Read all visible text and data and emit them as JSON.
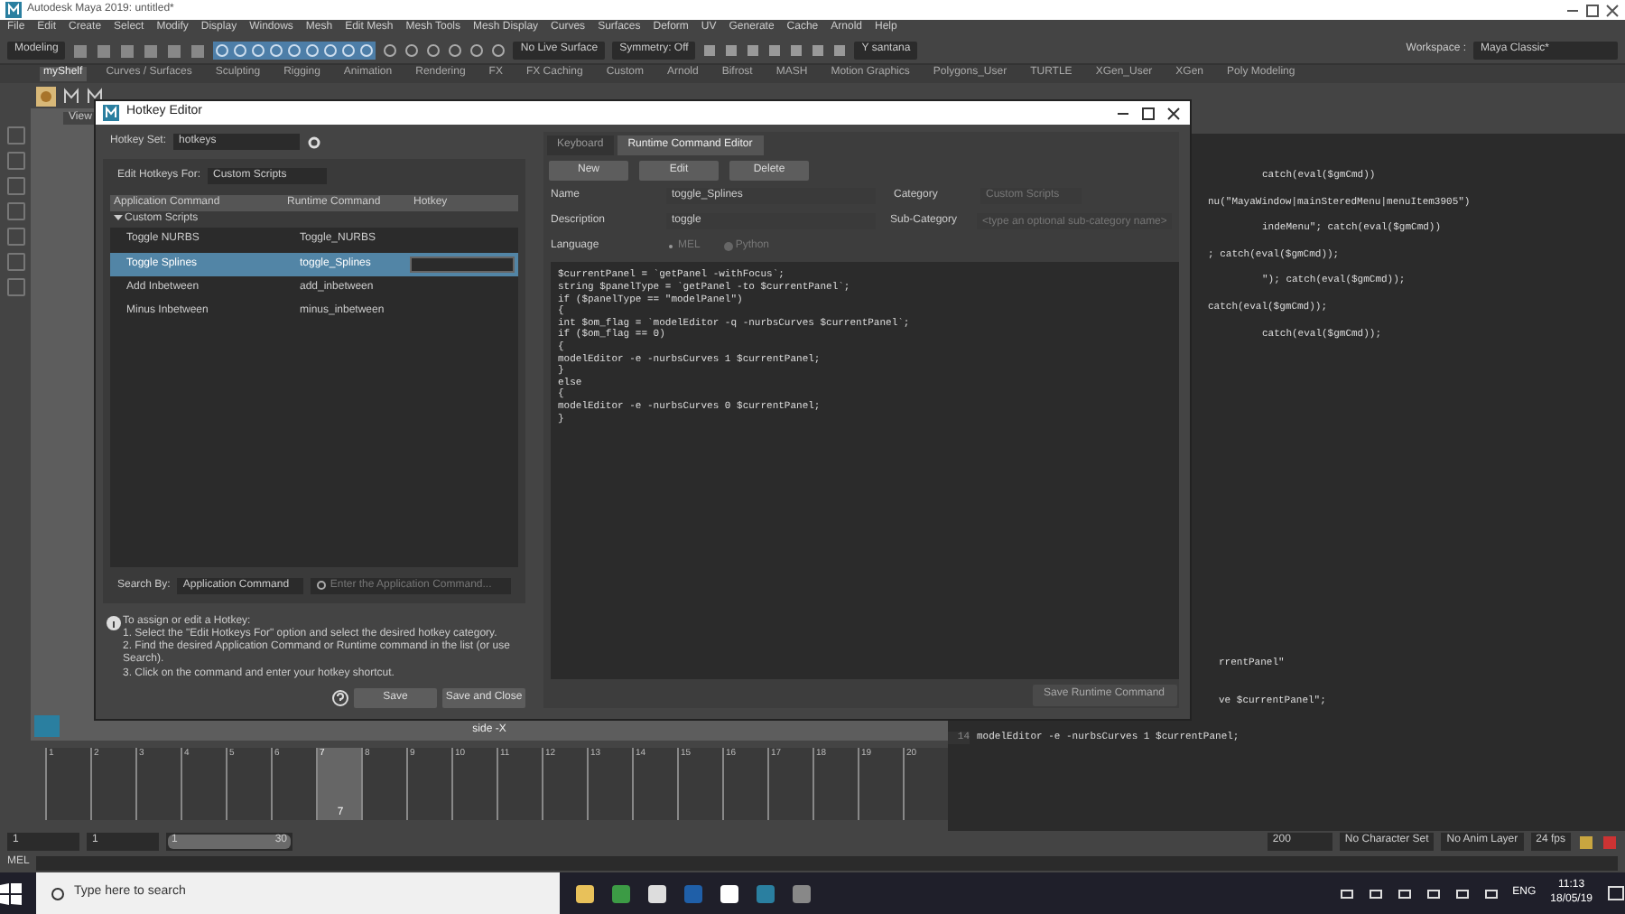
{
  "window": {
    "title": "Autodesk Maya 2019: untitled*"
  },
  "menu": [
    "File",
    "Edit",
    "Create",
    "Select",
    "Modify",
    "Display",
    "Windows",
    "Mesh",
    "Edit Mesh",
    "Mesh Tools",
    "Mesh Display",
    "Curves",
    "Surfaces",
    "Deform",
    "UV",
    "Generate",
    "Cache",
    "Arnold",
    "Help"
  ],
  "toolbar": {
    "mode": "Modeling",
    "live_surface": "No Live Surface",
    "symmetry": "Symmetry: Off",
    "user": "Y santana",
    "workspace_label": "Workspace :",
    "workspace": "Maya Classic*"
  },
  "shelf_tabs": [
    {
      "label": "myShelf",
      "selected": true
    },
    {
      "label": "Curves / Surfaces",
      "selected": false
    },
    {
      "label": "Sculpting",
      "selected": false
    },
    {
      "label": "Rigging",
      "selected": false
    },
    {
      "label": "Animation",
      "selected": false
    },
    {
      "label": "Rendering",
      "selected": false
    },
    {
      "label": "FX",
      "selected": false
    },
    {
      "label": "FX Caching",
      "selected": false
    },
    {
      "label": "Custom",
      "selected": false
    },
    {
      "label": "Arnold",
      "selected": false
    },
    {
      "label": "Bifrost",
      "selected": false
    },
    {
      "label": "MASH",
      "selected": false
    },
    {
      "label": "Motion Graphics",
      "selected": false
    },
    {
      "label": "Polygons_User",
      "selected": false
    },
    {
      "label": "TURTLE",
      "selected": false
    },
    {
      "label": "XGen_User",
      "selected": false
    },
    {
      "label": "XGen",
      "selected": false
    },
    {
      "label": "Poly Modeling",
      "selected": false
    }
  ],
  "viewport": {
    "tab": "View",
    "camera_label": "side -X"
  },
  "script_editor": {
    "upper_lines": [
      "catch(eval($gmCmd))",
      "nu(\"MayaWindow|mainSteredMenu|menuItem3905\")",
      "indeMenu\"; catch(eval($gmCmd))",
      "; catch(eval($gmCmd));",
      "\"); catch(eval($gmCmd));",
      "catch(eval($gmCmd));",
      "catch(eval($gmCmd));"
    ],
    "lower_lines": [
      {
        "text": "rrentPanel\""
      },
      {
        "text": "ve $currentPanel\";"
      },
      {
        "number": "14",
        "text": "modelEditor -e -nurbsCurves 1 $currentPanel;"
      }
    ]
  },
  "hotkey_editor": {
    "title": "Hotkey Editor",
    "hotkey_set_label": "Hotkey Set:",
    "hotkey_set": "hotkeys",
    "edit_for_label": "Edit Hotkeys For:",
    "edit_for": "Custom Scripts",
    "columns": [
      "Application Command",
      "Runtime Command",
      "Hotkey"
    ],
    "group": {
      "label": "Custom Scripts",
      "expanded": true
    },
    "rows": [
      {
        "command": "Toggle NURBS",
        "runtime": "Toggle_NURBS",
        "selected": false
      },
      {
        "command": "Toggle Splines",
        "runtime": "toggle_Splines",
        "selected": true
      },
      {
        "command": "Add Inbetween",
        "runtime": "add_inbetween",
        "selected": false
      },
      {
        "command": "Minus Inbetween",
        "runtime": "minus_inbetween",
        "selected": false
      }
    ],
    "search_by_label": "Search By:",
    "search_by": "Application Command",
    "search_placeholder": "Enter the Application Command...",
    "help_lines": [
      "To assign or edit a Hotkey:",
      "1. Select the \"Edit Hotkeys For\" option and select the desired hotkey category.",
      "2. Find the desired Application Command or Runtime command in the list (or use Search).",
      "3. Click on the command and enter your hotkey shortcut."
    ],
    "buttons": [
      "Save",
      "Save and Close"
    ],
    "tabs": [
      {
        "label": "Keyboard",
        "selected": false
      },
      {
        "label": "Runtime Command Editor",
        "selected": true
      }
    ],
    "rc_buttons": [
      "New",
      "Edit",
      "Delete"
    ],
    "name_label": "Name",
    "name": "toggle_Splines",
    "description_label": "Description",
    "description": "toggle",
    "category_label": "Category",
    "category": "Custom Scripts",
    "subcategory_label": "Sub-Category",
    "subcategory_placeholder": "<type an optional sub-category name>",
    "language_label": "Language",
    "languages": [
      {
        "label": "MEL",
        "selected": true
      },
      {
        "label": "Python",
        "selected": false
      }
    ],
    "code": [
      "$currentPanel = `getPanel -withFocus`;",
      "string $panelType = `getPanel -to $currentPanel`;",
      "if ($panelType == \"modelPanel\")",
      "{",
      "int $om_flag = `modelEditor -q -nurbsCurves $currentPanel`;",
      "if ($om_flag == 0)",
      "{",
      "modelEditor -e -nurbsCurves 1 $currentPanel;",
      "}",
      "else",
      "{",
      "modelEditor -e -nurbsCurves 0 $currentPanel;",
      "}"
    ],
    "save_runtime_button": {
      "label": "Save Runtime Command",
      "disabled": true
    }
  },
  "timeline": {
    "ticks": [
      "1",
      "2",
      "3",
      "4",
      "5",
      "6",
      "7",
      "8",
      "9",
      "10",
      "11",
      "12",
      "13",
      "14",
      "15",
      "16",
      "17",
      "18",
      "19",
      "20"
    ],
    "current": "7"
  },
  "range_bar": {
    "start": "1",
    "playback_start": "1",
    "slider_start": "1",
    "slider_end": "30",
    "level": 1,
    "end": "200",
    "character_set": "No Character Set",
    "anim_layer": "No Anim Layer",
    "fps": "24 fps"
  },
  "command_line": {
    "language": "MEL"
  },
  "taskbar": {
    "search_placeholder": "Type here to search",
    "language": "ENG",
    "time": "11:13",
    "date": "18/05/19"
  }
}
